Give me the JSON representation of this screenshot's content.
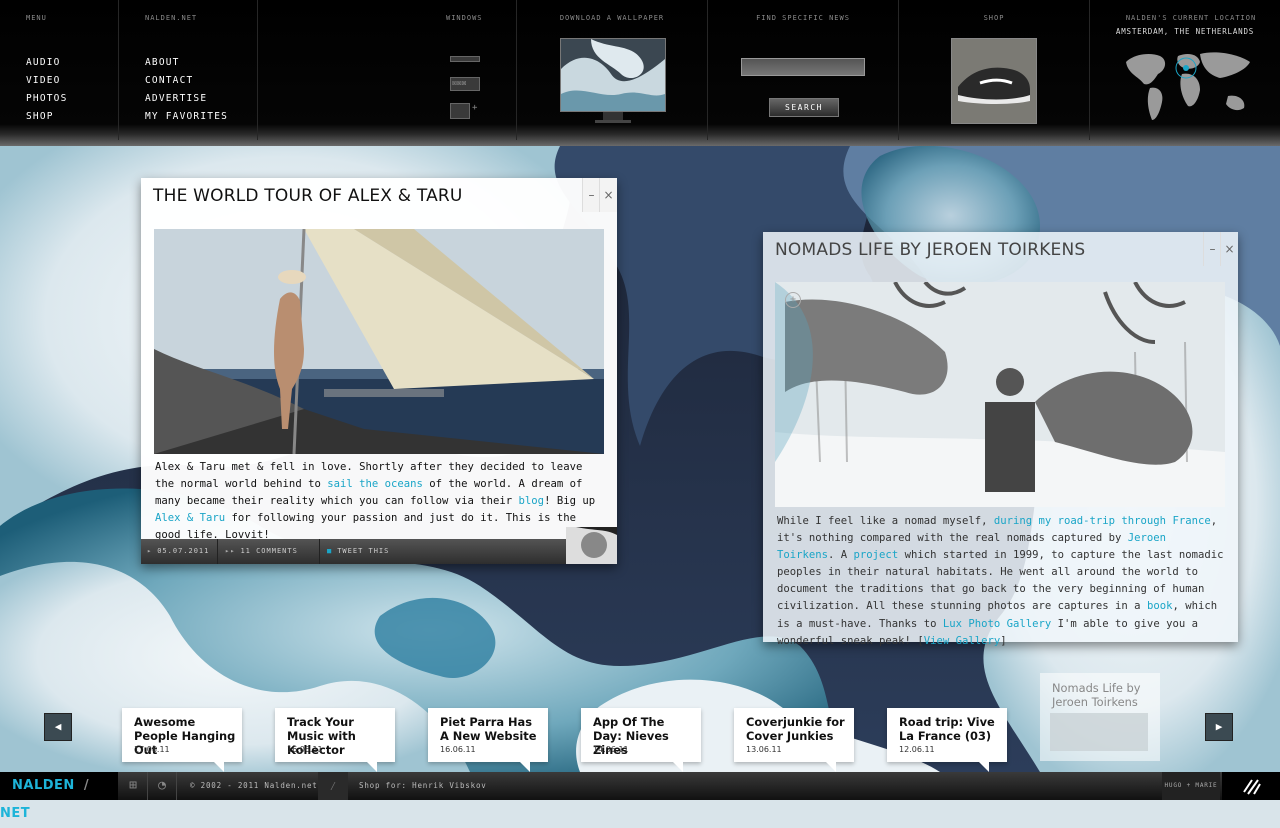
{
  "topbar": {
    "menu": {
      "heading": "MENU",
      "items": [
        "AUDIO",
        "VIDEO",
        "PHOTOS",
        "SHOP"
      ]
    },
    "site": {
      "heading": "NALDEN.NET",
      "items": [
        "ABOUT",
        "CONTACT",
        "ADVERTISE",
        "MY FAVORITES"
      ]
    },
    "windows": {
      "heading": "WINDOWS"
    },
    "wallpaper": {
      "heading": "DOWNLOAD A WALLPAPER"
    },
    "news": {
      "heading": "FIND SPECIFIC NEWS",
      "search_value": "",
      "search_button": "SEARCH"
    },
    "shop": {
      "heading": "SHOP"
    },
    "location": {
      "heading": "NALDEN'S CURRENT LOCATION",
      "place": "AMSTERDAM, THE NETHERLANDS"
    }
  },
  "post1": {
    "title": "THE WORLD TOUR OF ALEX & TARU",
    "minimize": "–",
    "close": "×",
    "text": [
      {
        "t": "Alex & Taru met & fell in love. Shortly after they decided to leave the normal world behind to "
      },
      {
        "link": "sail the oceans"
      },
      {
        "t": " of the world. A dream of many became their reality which you can follow via their "
      },
      {
        "link": "blog"
      },
      {
        "t": "! Big up "
      },
      {
        "link": "Alex & Taru"
      },
      {
        "t": " for following your passion and just do it. This is the good life. Lovvit!"
      }
    ],
    "date": "05.07.2011",
    "comments": "11 COMMENTS",
    "tweet": "TWEET THIS"
  },
  "post2": {
    "title": "NOMADS LIFE BY JEROEN TOIRKENS",
    "minimize": "–",
    "close": "×",
    "text": [
      {
        "t": "While I feel like a nomad myself, "
      },
      {
        "link": "during my road-trip through France"
      },
      {
        "t": ", it's nothing compared with the real nomads captured by "
      },
      {
        "link": "Jeroen Toirkens"
      },
      {
        "t": ". A "
      },
      {
        "link": "project"
      },
      {
        "t": " which started in 1999, to capture the last nomadic peoples in their natural habitats. He went all around the world to document the traditions that go back to the very beginning of human civilization. All these stunning photos are captures in a "
      },
      {
        "link": "book"
      },
      {
        "t": ", which is a must-have. Thanks to "
      },
      {
        "link": "Lux Photo Gallery"
      },
      {
        "t": " I'm able to give you a wonderful sneak peak! ["
      },
      {
        "link": "View Gallery"
      },
      {
        "t": "]"
      }
    ]
  },
  "tiles": [
    {
      "title": "Awesome People Hanging Out",
      "date": "17.06.11"
    },
    {
      "title": "Track Your Music with Kollector",
      "date": "16.06.11"
    },
    {
      "title": "Piet Parra Has A New Website",
      "date": "16.06.11"
    },
    {
      "title": "App Of The Day: Nieves Zines",
      "date": "14.06.11"
    },
    {
      "title": "Coverjunkie for Cover Junkies",
      "date": "13.06.11"
    },
    {
      "title": "Road trip: Vive La France (03)",
      "date": "12.06.11"
    }
  ],
  "tile_active": {
    "title": "Nomads Life by Jeroen Toirkens"
  },
  "nav": {
    "prev": "◀",
    "next": "▶"
  },
  "bottombar": {
    "logo_left": "NALDEN",
    "logo_sep": "/",
    "logo_right": "NET",
    "copyright": "© 2002 - 2011 Nalden.net",
    "shop_for": "Shop for:  Henrik Vibskov",
    "sponsor": "HUGO + MARIE"
  },
  "colors": {
    "accent": "#1aa5c7",
    "logo": "#1db4d9"
  }
}
